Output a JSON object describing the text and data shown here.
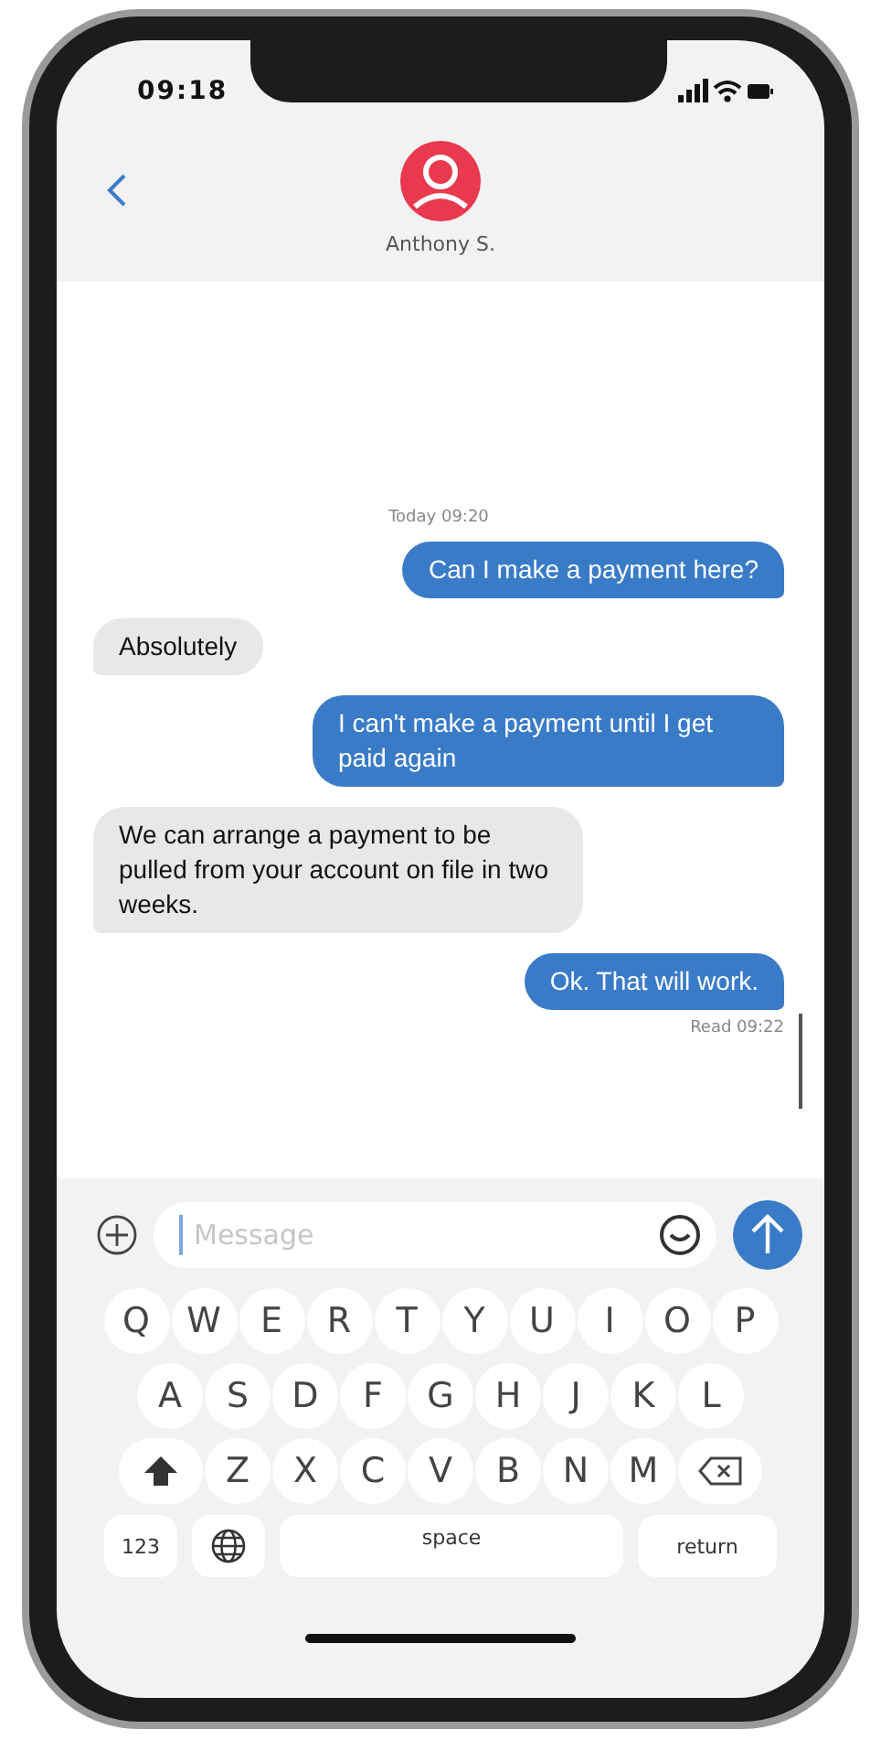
{
  "status_bar": {
    "time": "09:18"
  },
  "header": {
    "contact_name": "Anthony S."
  },
  "conversation": {
    "timestamp": "Today 09:20",
    "messages": [
      {
        "kind": "sent",
        "text": "Can I make a payment here?"
      },
      {
        "kind": "received",
        "text": "Absolutely"
      },
      {
        "kind": "sent",
        "text": "I can't make a payment until I get paid again"
      },
      {
        "kind": "received",
        "text": "We can arrange a payment to be pulled from your account on file in two weeks."
      },
      {
        "kind": "sent",
        "text": "Ok. That will work."
      }
    ],
    "read_receipt": "Read 09:22"
  },
  "composer": {
    "placeholder": "Message"
  },
  "keyboard": {
    "row_1": [
      "Q",
      "W",
      "E",
      "R",
      "T",
      "Y",
      "U",
      "I",
      "O",
      "P"
    ],
    "row_2": [
      "A",
      "S",
      "D",
      "F",
      "G",
      "H",
      "J",
      "K",
      "L"
    ],
    "row_3": [
      "Z",
      "X",
      "C",
      "V",
      "B",
      "N",
      "M"
    ],
    "number_key": "123",
    "space_key": "space",
    "return_key": "return"
  }
}
